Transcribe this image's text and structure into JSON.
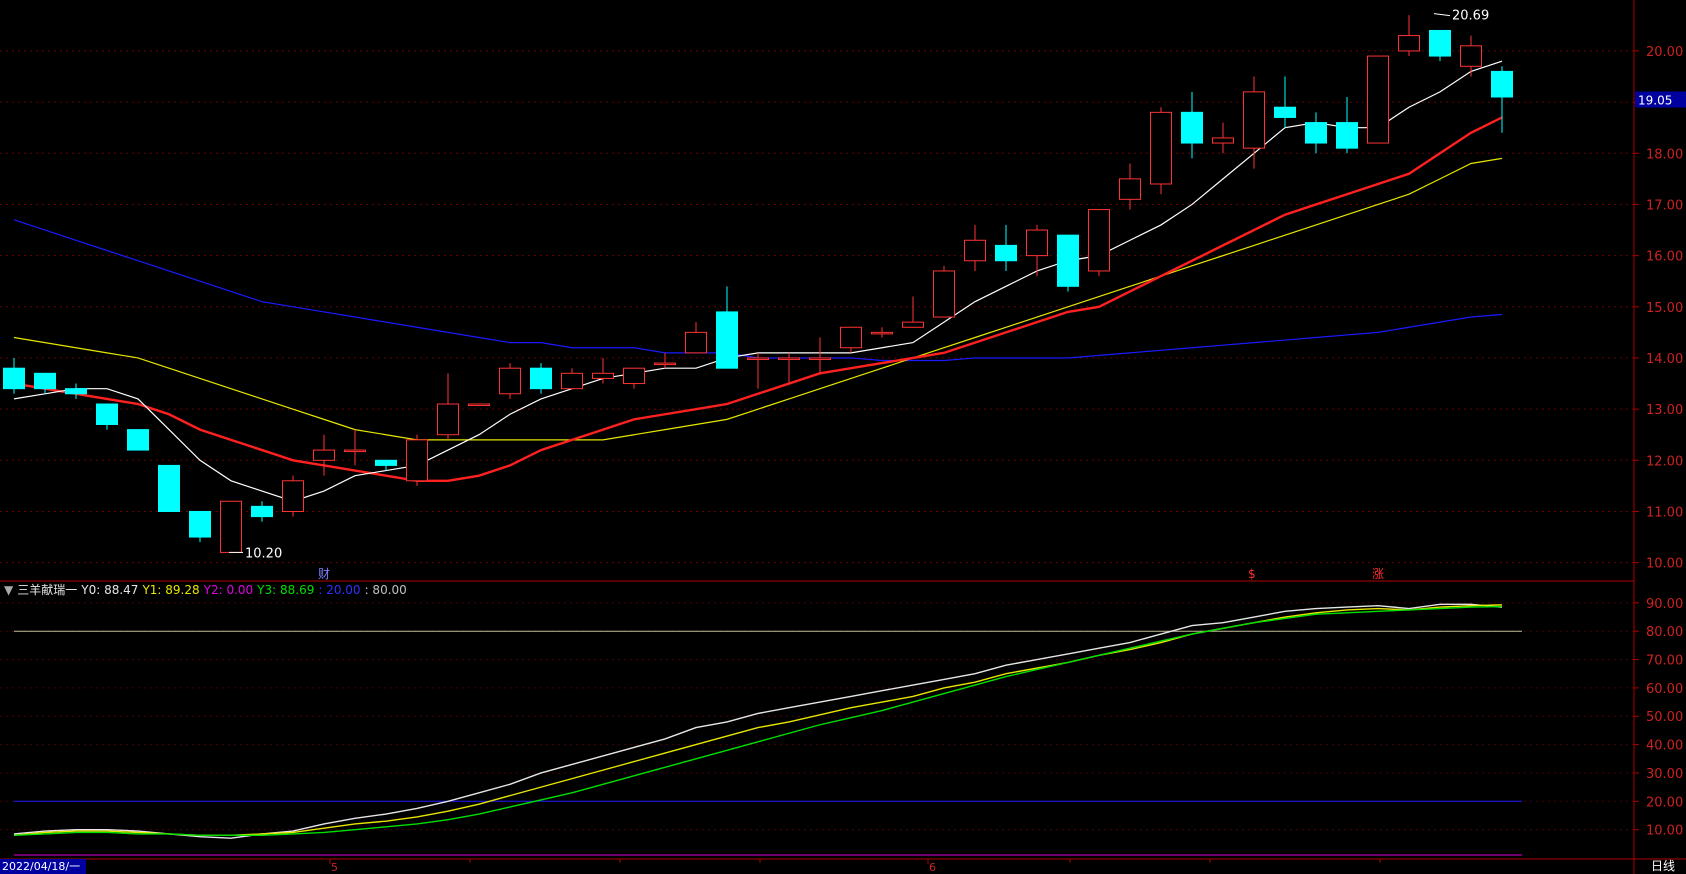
{
  "indicator": {
    "name": "三羊献瑞一",
    "y0": "Y0: 88.47",
    "y1": "Y1: 89.28",
    "y2": "Y2: 0.00",
    "y3": "Y3: 88.69",
    "lvl20": ": 20.00",
    "lvl80": ": 80.00"
  },
  "footer": {
    "date": "2022/04/18/一",
    "period": "日线"
  },
  "chart_data": [
    {
      "type": "candlestick",
      "ylim": [
        9.7,
        20.8
      ],
      "yticks": [
        "10.00",
        "11.00",
        "12.00",
        "13.00",
        "14.00",
        "15.00",
        "16.00",
        "17.00",
        "18.00",
        "19.00",
        "20.00"
      ],
      "ytick_values": [
        10,
        11,
        12,
        13,
        14,
        15,
        16,
        17,
        18,
        19,
        20
      ],
      "last_price_label": "19.05",
      "last_price": 19.05,
      "high_label": "20.69",
      "high_value": 20.69,
      "high_index": 46,
      "low_label": "10.20",
      "low_value": 10.2,
      "low_index": 7,
      "markers": [
        {
          "text": "财",
          "index": 10,
          "color": "#8080ff"
        },
        {
          "text": "$",
          "index": 40,
          "color": "#ff3030"
        },
        {
          "text": "涨",
          "index": 44,
          "color": "#ff3030"
        }
      ],
      "colors": {
        "up": "#ff3333",
        "down": "#00ffff",
        "ma5": "#ffffff",
        "ma10": "#ff2020",
        "ma30": "#e6e600",
        "ma120": "#1a1aff"
      },
      "ohlc": [
        [
          13.8,
          13.4,
          14.0,
          13.3
        ],
        [
          13.7,
          13.4,
          13.7,
          13.3
        ],
        [
          13.4,
          13.3,
          13.5,
          13.2
        ],
        [
          13.1,
          12.7,
          13.1,
          12.6
        ],
        [
          12.6,
          12.2,
          12.6,
          12.2
        ],
        [
          11.9,
          11.0,
          11.9,
          11.0
        ],
        [
          11.0,
          10.5,
          11.0,
          10.4
        ],
        [
          10.2,
          11.2,
          11.2,
          10.2
        ],
        [
          11.1,
          10.9,
          11.2,
          10.8
        ],
        [
          11.0,
          11.6,
          11.7,
          10.9
        ],
        [
          12.0,
          12.2,
          12.5,
          11.7
        ],
        [
          12.2,
          12.2,
          12.6,
          11.9
        ],
        [
          12.0,
          11.9,
          12.0,
          11.8
        ],
        [
          11.6,
          12.4,
          12.5,
          11.5
        ],
        [
          12.5,
          13.1,
          13.7,
          12.4
        ],
        [
          13.1,
          13.1,
          13.1,
          13.1
        ],
        [
          13.3,
          13.8,
          13.9,
          13.2
        ],
        [
          13.8,
          13.4,
          13.9,
          13.3
        ],
        [
          13.4,
          13.7,
          13.8,
          13.4
        ],
        [
          13.6,
          13.7,
          14.0,
          13.5
        ],
        [
          13.5,
          13.8,
          13.8,
          13.4
        ],
        [
          13.9,
          13.9,
          14.1,
          13.8
        ],
        [
          14.1,
          14.5,
          14.7,
          14.1
        ],
        [
          14.9,
          13.8,
          15.4,
          13.8
        ],
        [
          14.0,
          14.0,
          14.1,
          13.4
        ],
        [
          14.0,
          14.0,
          14.1,
          13.5
        ],
        [
          14.0,
          14.0,
          14.4,
          13.7
        ],
        [
          14.2,
          14.6,
          14.6,
          14.1
        ],
        [
          14.5,
          14.5,
          14.6,
          14.4
        ],
        [
          14.6,
          14.7,
          15.2,
          14.6
        ],
        [
          14.8,
          15.7,
          15.8,
          14.8
        ],
        [
          15.9,
          16.3,
          16.6,
          15.7
        ],
        [
          16.2,
          15.9,
          16.6,
          15.7
        ],
        [
          16.0,
          16.5,
          16.6,
          15.6
        ],
        [
          16.4,
          15.4,
          16.4,
          15.3
        ],
        [
          15.7,
          16.9,
          16.9,
          15.6
        ],
        [
          17.1,
          17.5,
          17.8,
          16.9
        ],
        [
          17.4,
          18.8,
          18.9,
          17.2
        ],
        [
          18.8,
          18.2,
          19.2,
          17.9
        ],
        [
          18.2,
          18.3,
          18.6,
          18.0
        ],
        [
          18.1,
          19.2,
          19.5,
          17.7
        ],
        [
          18.9,
          18.7,
          19.5,
          18.5
        ],
        [
          18.6,
          18.2,
          18.8,
          18.0
        ],
        [
          18.6,
          18.1,
          19.1,
          18.0
        ],
        [
          18.2,
          19.9,
          19.9,
          18.2
        ],
        [
          20.0,
          20.3,
          20.7,
          19.9
        ],
        [
          20.4,
          19.9,
          20.4,
          19.8
        ],
        [
          19.7,
          20.1,
          20.3,
          19.5
        ],
        [
          19.6,
          19.1,
          19.7,
          18.4
        ]
      ],
      "ma5": [
        13.2,
        13.3,
        13.4,
        13.4,
        13.2,
        12.6,
        12.0,
        11.6,
        11.4,
        11.2,
        11.4,
        11.7,
        11.8,
        11.9,
        12.2,
        12.5,
        12.9,
        13.2,
        13.4,
        13.6,
        13.7,
        13.8,
        13.8,
        14.0,
        14.1,
        14.1,
        14.1,
        14.1,
        14.2,
        14.3,
        14.7,
        15.1,
        15.4,
        15.7,
        15.9,
        16.0,
        16.3,
        16.6,
        17.0,
        17.5,
        18.0,
        18.5,
        18.6,
        18.5,
        18.5,
        18.9,
        19.2,
        19.6,
        19.8
      ],
      "ma10": [
        13.5,
        13.4,
        13.3,
        13.2,
        13.1,
        12.9,
        12.6,
        12.4,
        12.2,
        12.0,
        11.9,
        11.8,
        11.7,
        11.6,
        11.6,
        11.7,
        11.9,
        12.2,
        12.4,
        12.6,
        12.8,
        12.9,
        13.0,
        13.1,
        13.3,
        13.5,
        13.7,
        13.8,
        13.9,
        14.0,
        14.1,
        14.3,
        14.5,
        14.7,
        14.9,
        15.0,
        15.3,
        15.6,
        15.9,
        16.2,
        16.5,
        16.8,
        17.0,
        17.2,
        17.4,
        17.6,
        18.0,
        18.4,
        18.7,
        18.9,
        19.1
      ],
      "ma30": [
        14.4,
        14.3,
        14.2,
        14.1,
        14.0,
        13.8,
        13.6,
        13.4,
        13.2,
        13.0,
        12.8,
        12.6,
        12.5,
        12.4,
        12.4,
        12.4,
        12.4,
        12.4,
        12.4,
        12.4,
        12.5,
        12.6,
        12.7,
        12.8,
        13.0,
        13.2,
        13.4,
        13.6,
        13.8,
        14.0,
        14.2,
        14.4,
        14.6,
        14.8,
        15.0,
        15.2,
        15.4,
        15.6,
        15.8,
        16.0,
        16.2,
        16.4,
        16.6,
        16.8,
        17.0,
        17.2,
        17.5,
        17.8,
        17.9
      ],
      "ma120": [
        16.7,
        16.5,
        16.3,
        16.1,
        15.9,
        15.7,
        15.5,
        15.3,
        15.1,
        15.0,
        14.9,
        14.8,
        14.7,
        14.6,
        14.5,
        14.4,
        14.3,
        14.3,
        14.2,
        14.2,
        14.2,
        14.1,
        14.1,
        14.1,
        14.0,
        14.0,
        14.0,
        14.0,
        13.95,
        13.95,
        13.95,
        14.0,
        14.0,
        14.0,
        14.0,
        14.05,
        14.1,
        14.15,
        14.2,
        14.25,
        14.3,
        14.35,
        14.4,
        14.45,
        14.5,
        14.6,
        14.7,
        14.8,
        14.85
      ]
    },
    {
      "type": "line",
      "ylim": [
        0,
        97
      ],
      "yticks": [
        "10.00",
        "20.00",
        "30.00",
        "40.00",
        "50.00",
        "60.00",
        "70.00",
        "80.00",
        "90.00"
      ],
      "ytick_values": [
        10,
        20,
        30,
        40,
        50,
        60,
        70,
        80,
        90
      ],
      "levels": [
        {
          "value": 80,
          "color": "#c0c0a0"
        },
        {
          "value": 20,
          "color": "#1a1aff"
        },
        {
          "value": 0,
          "color": "#e000e0"
        }
      ],
      "series": [
        {
          "color": "#e6e6e6",
          "values": [
            8.5,
            9.5,
            10,
            10,
            9.5,
            8.5,
            7.5,
            7,
            8.5,
            9.5,
            12,
            14,
            15.5,
            17.5,
            20,
            23,
            26,
            30,
            33,
            36,
            39,
            42,
            46,
            48,
            51,
            53,
            55,
            57,
            59,
            61,
            63,
            65,
            68,
            70,
            72,
            74,
            76,
            79,
            82,
            83,
            85,
            87,
            88,
            88.5,
            89,
            88,
            89.5,
            89.5,
            88.47
          ]
        },
        {
          "color": "#e6e600",
          "values": [
            8,
            9,
            9.5,
            9.5,
            9,
            8.5,
            8,
            8,
            8.5,
            9,
            10.5,
            12,
            13,
            14.5,
            16.5,
            19,
            22,
            25,
            28,
            31,
            34,
            37,
            40,
            43,
            46,
            48,
            50.5,
            53,
            55,
            57,
            60,
            62,
            65,
            67,
            69,
            71.5,
            73.5,
            76,
            79,
            81,
            83,
            85,
            86.5,
            87.5,
            88,
            87.5,
            88.5,
            89,
            89.28
          ]
        },
        {
          "color": "#00e000",
          "values": [
            8,
            8.5,
            9,
            9,
            8.5,
            8.5,
            8,
            8,
            8,
            8.5,
            9,
            10,
            11,
            12,
            13.5,
            15.5,
            18,
            20.5,
            23,
            26,
            29,
            32,
            35,
            38,
            41,
            44,
            47,
            49.5,
            52,
            55,
            58,
            61,
            64,
            66.5,
            69,
            71.5,
            74,
            76.5,
            79,
            81,
            83,
            84.5,
            86,
            86.5,
            87,
            87.5,
            88,
            88.5,
            88.69
          ]
        }
      ]
    }
  ]
}
